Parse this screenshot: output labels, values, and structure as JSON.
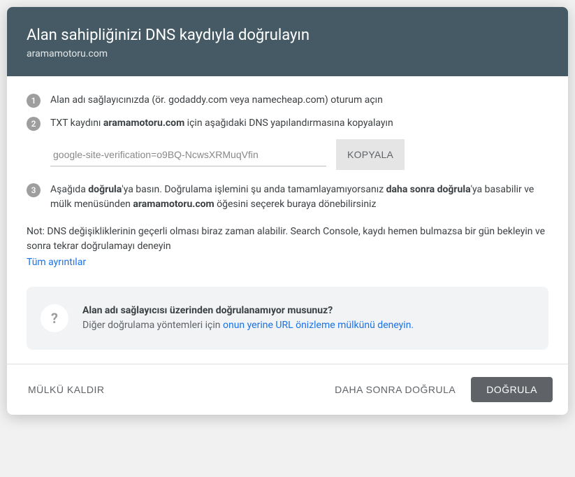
{
  "header": {
    "title": "Alan sahipliğinizi DNS kaydıyla doğrulayın",
    "subtitle": "aramamotoru.com"
  },
  "steps": {
    "s1": {
      "num": "1",
      "text": "Alan adı sağlayıcınızda (ör. godaddy.com veya namecheap.com) oturum açın"
    },
    "s2": {
      "num": "2",
      "pre": "TXT kaydını ",
      "bold": "aramamotoru.com",
      "post": " için aşağıdaki DNS yapılandırmasına kopyalayın",
      "record": "google-site-verification=o9BQ-NcwsXRMuqVfin",
      "copy": "KOPYALA"
    },
    "s3": {
      "num": "3",
      "p1": "Aşağıda ",
      "b1": "doğrula",
      "p2": "'ya basın. Doğrulama işlemini şu anda tamamlayamıyorsanız ",
      "b2": "daha sonra doğrula",
      "p3": "'ya basabilir ve mülk menüsünden ",
      "b3": "aramamotoru.com",
      "p4": " öğesini seçerek buraya dönebilirsiniz"
    }
  },
  "note": "Not: DNS değişikliklerinin geçerli olması biraz zaman alabilir. Search Console, kaydı hemen bulmazsa bir gün bekleyin ve sonra tekrar doğrulamayı deneyin",
  "details_link": "Tüm ayrıntılar",
  "info": {
    "icon": "?",
    "title": "Alan adı sağlayıcısı üzerinden doğrulanamıyor musunuz?",
    "desc": "Diğer doğrulama yöntemleri için ",
    "link": "onun yerine URL önizleme mülkünü deneyin."
  },
  "footer": {
    "remove": "MÜLKÜ KALDIR",
    "later": "DAHA SONRA DOĞRULA",
    "verify": "DOĞRULA"
  }
}
